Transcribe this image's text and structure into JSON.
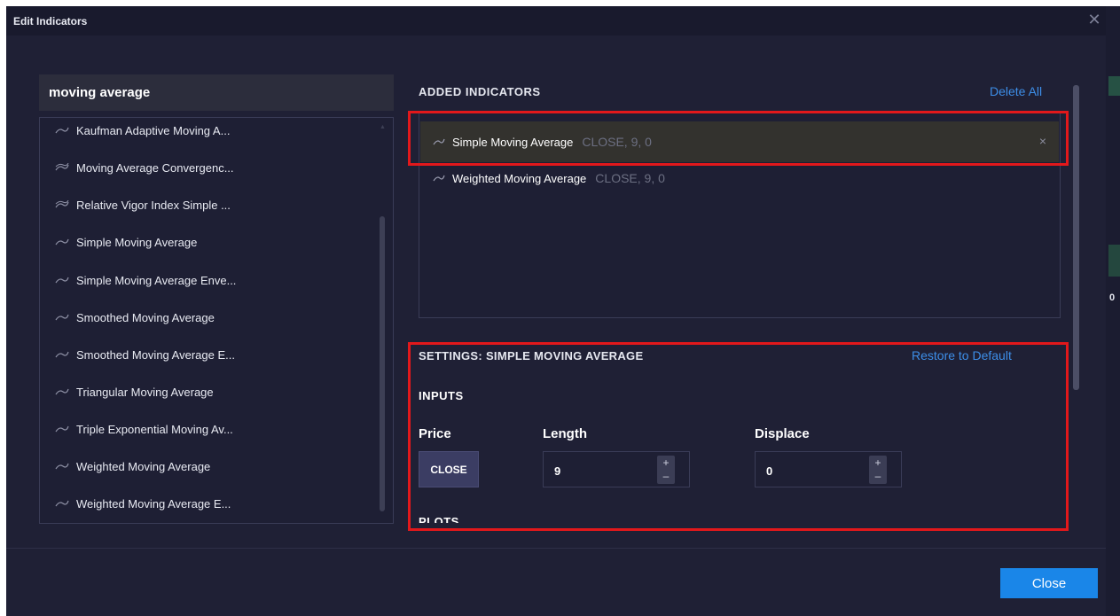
{
  "window": {
    "title": "Edit Indicators"
  },
  "search": {
    "value": "moving average"
  },
  "indicator_list": [
    {
      "label": "Kaufman Adaptive Moving A...",
      "icon": "line-icon"
    },
    {
      "label": "Moving Average Convergenc...",
      "icon": "double-line-icon"
    },
    {
      "label": "Relative Vigor Index Simple ...",
      "icon": "double-line-icon"
    },
    {
      "label": "Simple Moving Average",
      "icon": "line-icon"
    },
    {
      "label": "Simple Moving Average Enve...",
      "icon": "line-icon"
    },
    {
      "label": "Smoothed Moving Average",
      "icon": "line-icon"
    },
    {
      "label": "Smoothed Moving Average E...",
      "icon": "line-icon"
    },
    {
      "label": "Triangular Moving Average",
      "icon": "line-icon"
    },
    {
      "label": "Triple Exponential Moving Av...",
      "icon": "line-icon"
    },
    {
      "label": "Weighted Moving Average",
      "icon": "line-icon"
    },
    {
      "label": "Weighted Moving Average E...",
      "icon": "line-icon"
    }
  ],
  "added": {
    "title": "ADDED INDICATORS",
    "delete_all": "Delete All",
    "items": [
      {
        "name": "Simple Moving Average",
        "params": "CLOSE, 9, 0",
        "selected": true,
        "remove": "×"
      },
      {
        "name": "Weighted Moving Average",
        "params": "CLOSE, 9, 0",
        "selected": false
      }
    ]
  },
  "settings": {
    "title": "SETTINGS: SIMPLE MOVING AVERAGE",
    "restore": "Restore to Default",
    "inputs_heading": "INPUTS",
    "price_label": "Price",
    "price_value": "CLOSE",
    "length_label": "Length",
    "length_value": "9",
    "displace_label": "Displace",
    "displace_value": "0",
    "plus": "+",
    "minus": "–",
    "plots_heading": "PLOTS"
  },
  "footer": {
    "close_label": "Close"
  },
  "side_strip": {
    "number": "0"
  },
  "colors": {
    "accent": "#1a86e8",
    "link": "#3d8ee8",
    "highlight": "#e2181b",
    "bg": "#1f2035"
  }
}
